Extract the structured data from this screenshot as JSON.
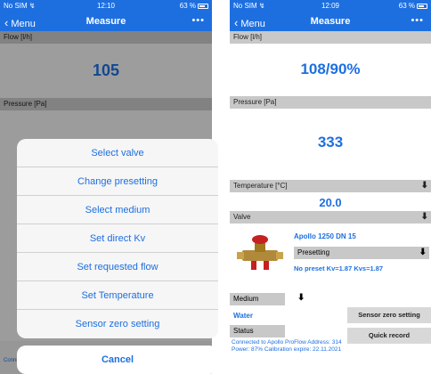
{
  "left": {
    "status": {
      "carrier": "No SIM ↯",
      "time": "12:10",
      "battery": "63 %"
    },
    "nav": {
      "back": "Menu",
      "title": "Measure",
      "more": "•••"
    },
    "flow": {
      "label": "Flow [l/h]",
      "value": "105"
    },
    "pressure": {
      "label": "Pressure [Pa]"
    },
    "status_line": "Connected to Apollo ProFlow",
    "action_sheet": {
      "items": [
        "Select valve",
        "Change presetting",
        "Select medium",
        "Set direct Kv",
        "Set requested flow",
        "Set Temperature",
        "Sensor zero setting"
      ],
      "cancel": "Cancel"
    }
  },
  "right": {
    "status": {
      "carrier": "No SIM ↯",
      "time": "12:09",
      "battery": "63 %"
    },
    "nav": {
      "back": "Menu",
      "title": "Measure",
      "more": "•••"
    },
    "flow": {
      "label": "Flow [l/h]",
      "value": "108/90%"
    },
    "pressure": {
      "label": "Pressure [Pa]",
      "value": "333"
    },
    "temperature": {
      "label": "Temperature [°C]",
      "value": "20.0"
    },
    "valve": {
      "label": "Valve",
      "name": "Apollo 1250 DN 15",
      "presetting_label": "Presetting",
      "preset_info": "No preset Kv=1.87 Kvs=1.87"
    },
    "medium": {
      "label": "Medium",
      "value": "Water"
    },
    "status_section": {
      "label": "Status",
      "text": "Connected to Apollo ProFlow Address: 314 Power: 87% Calibration expire: 22.11.2021"
    },
    "buttons": {
      "zero": "Sensor zero setting",
      "quick": "Quick record"
    }
  },
  "colors": {
    "accent": "#1d6fe0",
    "header_gray": "#c8c8c8"
  },
  "icons": [
    "wifi-icon",
    "battery-icon",
    "chevron-left-icon",
    "more-icon",
    "download-icon",
    "valve-image"
  ]
}
